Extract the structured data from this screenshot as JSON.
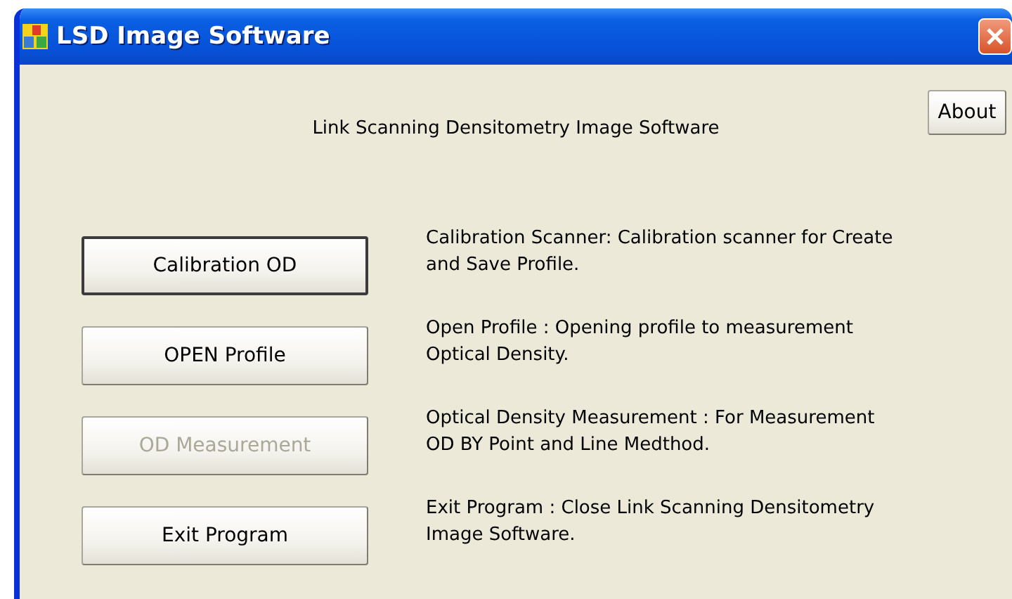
{
  "window": {
    "title": "LSD Image Software"
  },
  "about_button": "About",
  "heading": "Link Scanning Densitometry Image Software",
  "actions": [
    {
      "label": "Calibration OD",
      "default": true,
      "disabled": false,
      "description": "Calibration Scanner: Calibration scanner for Create and Save Profile."
    },
    {
      "label": "OPEN Profile",
      "default": false,
      "disabled": false,
      "description": "Open Profile : Opening profile to measurement Optical Density."
    },
    {
      "label": "OD Measurement",
      "default": false,
      "disabled": true,
      "description": "Optical Density Measurement : For Measurement OD BY  Point and Line Medthod."
    },
    {
      "label": "Exit Program",
      "default": false,
      "disabled": false,
      "description": "Exit Program : Close Link Scanning Densitometry Image Software."
    }
  ]
}
